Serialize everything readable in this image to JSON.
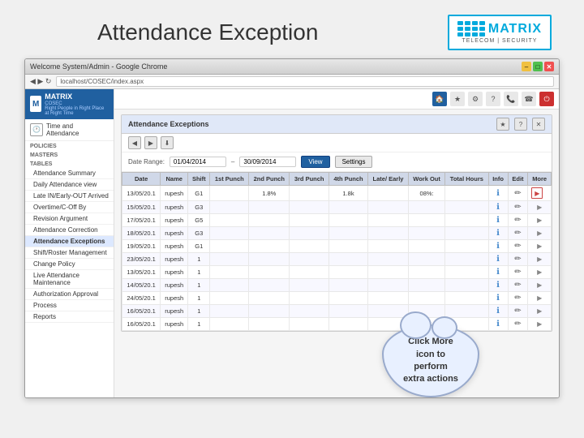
{
  "header": {
    "title": "Attendance Exception",
    "logo": {
      "brand": "MATRIX",
      "tagline": "TELECOM | SECURITY"
    }
  },
  "browser": {
    "title": "Welcome System/Admin - Google Chrome",
    "address": "localhost/COSEC/index.aspx"
  },
  "app": {
    "logo": {
      "name": "MATRIX",
      "tagline": "COSEC",
      "subtitle": "Right People in Right Place at Right Time"
    },
    "topbar_icons": [
      "🏠",
      "★",
      "⚙",
      "?",
      "📞",
      "☎",
      "⏻"
    ],
    "module": {
      "icon": "🕐",
      "label": "Time and",
      "label2": "Attendance"
    },
    "sidebar_sections": {
      "policies": "Policies",
      "masters": "Masters",
      "tables": "Tables"
    },
    "nav_items": [
      "Attendance Summary",
      "Daily Attendance view",
      "Late IN/Early-OUT Arrived",
      "Overtime/C-Off By",
      "Revision Argument",
      "Attendance Correction",
      "Attendance Exceptions",
      "Shift/Roster Management",
      "Change Policy",
      "Live Attendance Maintenance",
      "Authorization Approval",
      "Process",
      "Reports"
    ],
    "panel_title": "Attendance Exceptions",
    "filter": {
      "date_range_label": "Date Range:",
      "date_from": "01/04/2014",
      "date_to": "30/09/2014",
      "view_btn": "View",
      "settings_btn": "Settings"
    },
    "table": {
      "columns": [
        "Date",
        "Name",
        "Shift",
        "1st Punch",
        "2nd Punch",
        "3rd Punch",
        "4th Punch",
        "Late Early",
        "Work Out",
        "Total Hours",
        "Info",
        "Edit",
        "More"
      ],
      "rows": [
        [
          "13/05/20.1",
          "rupesh",
          "G1",
          "",
          "1.8%",
          "",
          "1.8k",
          "",
          "08%:",
          "",
          "",
          "",
          ""
        ],
        [
          "15/05/20.1",
          "rupesh",
          "G3",
          "",
          "",
          "",
          "",
          "",
          "",
          "",
          "",
          "",
          ""
        ],
        [
          "17/05/20.1",
          "rupesh",
          "G5",
          "",
          "",
          "",
          "",
          "",
          "",
          "",
          "",
          "",
          ""
        ],
        [
          "18/05/20.1",
          "rupesh",
          "G3",
          "",
          "",
          "",
          "",
          "",
          "",
          "",
          "",
          "",
          ""
        ],
        [
          "19/05/20.1",
          "rupesh",
          "G1",
          "",
          "",
          "",
          "",
          "",
          "",
          "",
          "",
          "",
          ""
        ],
        [
          "23/05/20.1",
          "rupesh",
          "1",
          "",
          "",
          "",
          "",
          "",
          "",
          "",
          "",
          "",
          ""
        ],
        [
          "13/05/20.1",
          "rupesh",
          "1",
          "",
          "",
          "",
          "",
          "",
          "",
          "",
          "",
          "",
          ""
        ],
        [
          "14/05/20.1",
          "rupesh",
          "1",
          "",
          "",
          "",
          "",
          "",
          "",
          "",
          "",
          "",
          ""
        ],
        [
          "24/05/20.1",
          "rupesh",
          "1",
          "",
          "",
          "",
          "",
          "",
          "",
          "",
          "",
          "",
          ""
        ],
        [
          "16/05/20.1",
          "rupesh",
          "1",
          "",
          "",
          "",
          "",
          "",
          "",
          "",
          "",
          "",
          ""
        ],
        [
          "16/05/20.1",
          "rupesh",
          "1",
          "",
          "",
          "",
          "",
          "",
          "",
          "",
          "",
          "",
          ""
        ]
      ]
    },
    "callout": {
      "text": "Click More\nicon to\nperform\nextra actions"
    }
  }
}
